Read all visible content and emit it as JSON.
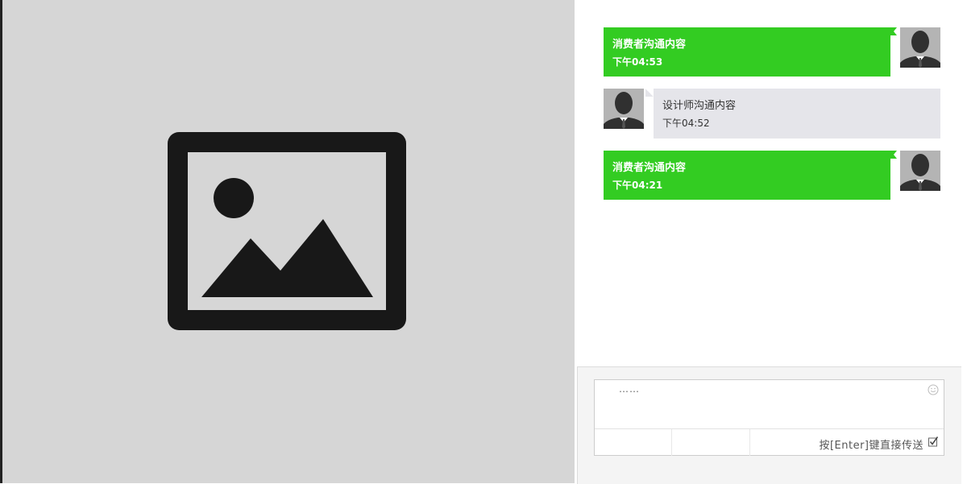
{
  "messages": [
    {
      "sender": "consumer",
      "text": "消费者沟通内容",
      "time": "下午04:53"
    },
    {
      "sender": "designer",
      "text": "设计师沟通内容",
      "time": "下午04:52"
    },
    {
      "sender": "consumer",
      "text": "消费者沟通内容",
      "time": "下午04:21"
    }
  ],
  "composer": {
    "text": "……",
    "send_on_enter_label": "按[Enter]键直接传送",
    "send_on_enter_checked": true
  },
  "colors": {
    "consumer_bubble": "#33cc22",
    "designer_bubble": "#e5e5ea",
    "image_panel_bg": "#d6d6d6"
  },
  "icons": {
    "image_placeholder": "image-placeholder-icon",
    "avatar": "user-avatar-icon",
    "emoji": "smile-icon",
    "checkbox": "checkbox-checked-icon"
  }
}
